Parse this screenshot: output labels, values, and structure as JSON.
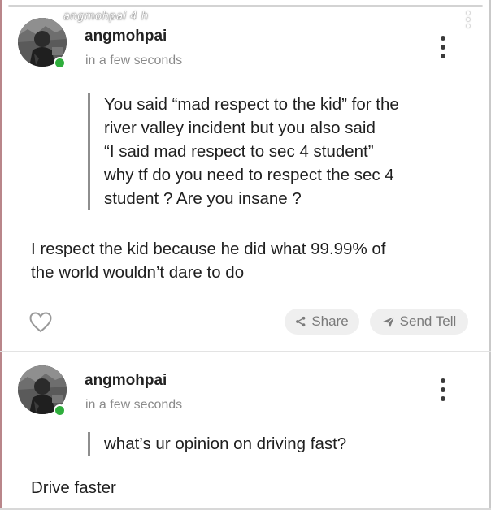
{
  "story_overlay": {
    "username": "angmohpai",
    "age": "4 h"
  },
  "posts": [
    {
      "username": "angmohpai",
      "timestamp": "in a few seconds",
      "question_lines": [
        "You said “mad respect to the kid” for the",
        "river valley incident but you also said",
        "“I said mad respect to sec 4 student”",
        "why tf do you need to respect the sec 4",
        "student ? Are you insane ?"
      ],
      "answer_lines": [
        "I respect the kid because he did what 99.99% of",
        "the world wouldn’t dare to do"
      ],
      "actions": {
        "like_icon": "heart-outline-icon",
        "share_label": "Share",
        "share_icon": "share-icon",
        "send_tell_label": "Send Tell",
        "send_tell_icon": "paper-plane-icon"
      }
    },
    {
      "username": "angmohpai",
      "timestamp": "in a few seconds",
      "question_lines": [
        "what’s ur opinion on driving fast?"
      ],
      "answer_lines": [
        "Drive faster"
      ]
    }
  ],
  "colors": {
    "online_dot": "#2fae3c",
    "pill_background": "#efefef",
    "muted_text": "#8a8a8a"
  }
}
